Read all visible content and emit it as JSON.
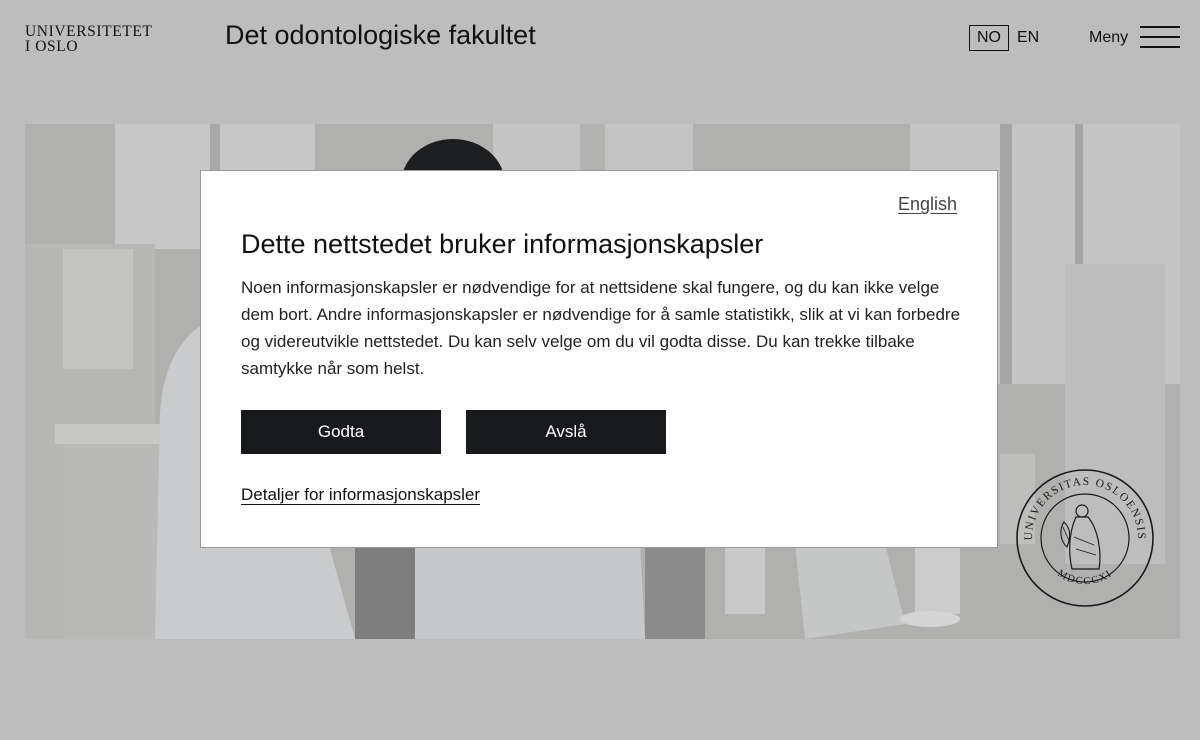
{
  "header": {
    "logo_line1": "UNIVERSITETET",
    "logo_line2": "I OSLO",
    "faculty_title": "Det odontologiske fakultet",
    "lang_no": "NO",
    "lang_en": "EN",
    "menu_label": "Meny"
  },
  "seal": {
    "text_top": "UNIVERSITAS OSLOENSIS",
    "text_bottom": "MDCCCXI"
  },
  "cookie_dialog": {
    "language_link": "English",
    "title": "Dette nettstedet bruker informasjonskapsler",
    "body": "Noen informasjonskapsler er nødvendige for at nettsidene skal fungere, og du kan ikke velge dem bort. Andre informasjonskapsler er nødvendige for å samle statistikk, slik at vi kan forbedre og videreutvikle nettstedet. Du kan selv velge om du vil godta disse. Du kan trekke tilbake samtykke når som helst.",
    "accept_label": "Godta",
    "decline_label": "Avslå",
    "details_link": "Detaljer for informasjonskapsler"
  },
  "colors": {
    "overlay_background": "#bdbdbd",
    "button_background": "#18191c",
    "button_text": "#ffffff"
  },
  "icons": [
    "hamburger-menu-icon",
    "university-seal"
  ]
}
